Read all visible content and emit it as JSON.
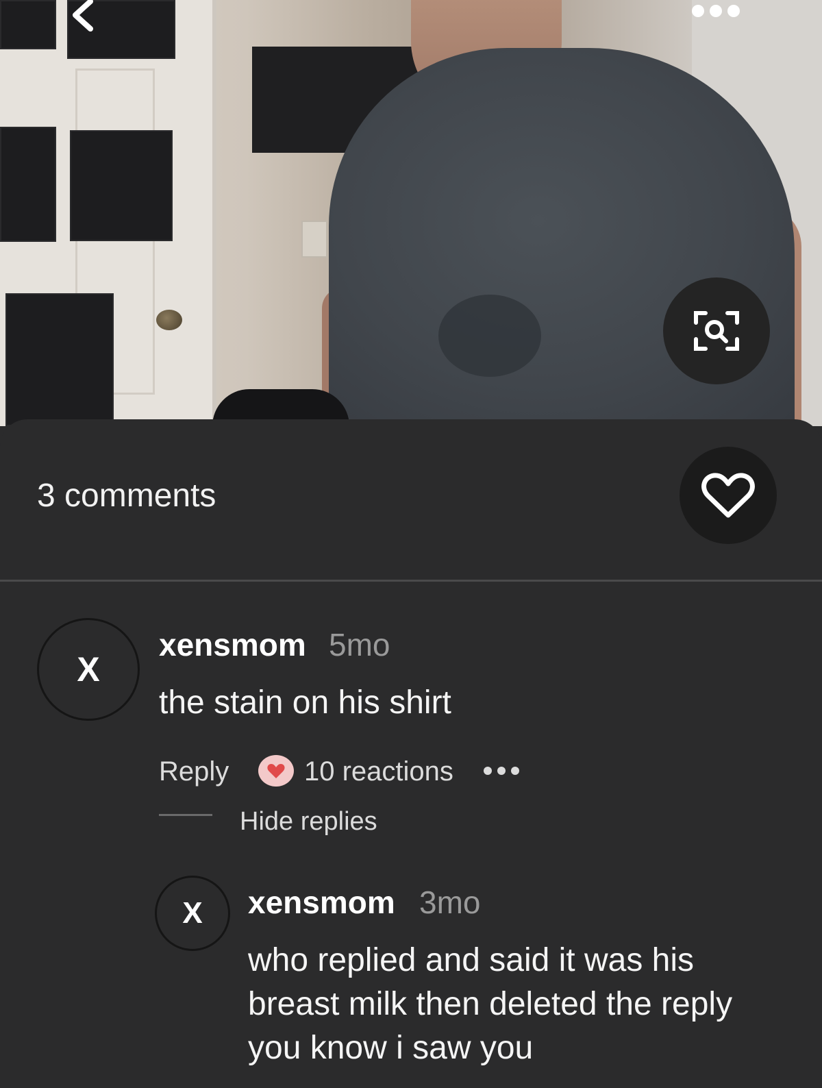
{
  "comments_header": {
    "count_label": "3 comments"
  },
  "comments": [
    {
      "avatar_letter": "X",
      "username": "xensmom",
      "time": "5mo",
      "text": "the stain on his shirt",
      "reply_label": "Reply",
      "reactions_label": "10 reactions",
      "hide_replies_label": "Hide replies"
    },
    {
      "avatar_letter": "X",
      "username": "xensmom",
      "time": "3mo",
      "text": "who replied and said it was his breast milk then deleted the reply you know i saw you"
    }
  ],
  "icons": {
    "back": "chevron-left-icon",
    "more": "more-horizontal-icon",
    "lens": "visual-search-icon",
    "like": "heart-outline-icon",
    "reaction": "heart-icon"
  },
  "colors": {
    "background": "#2b2b2c",
    "reaction_badge": "#f3c9c9",
    "reaction_heart": "#e04a4a"
  }
}
